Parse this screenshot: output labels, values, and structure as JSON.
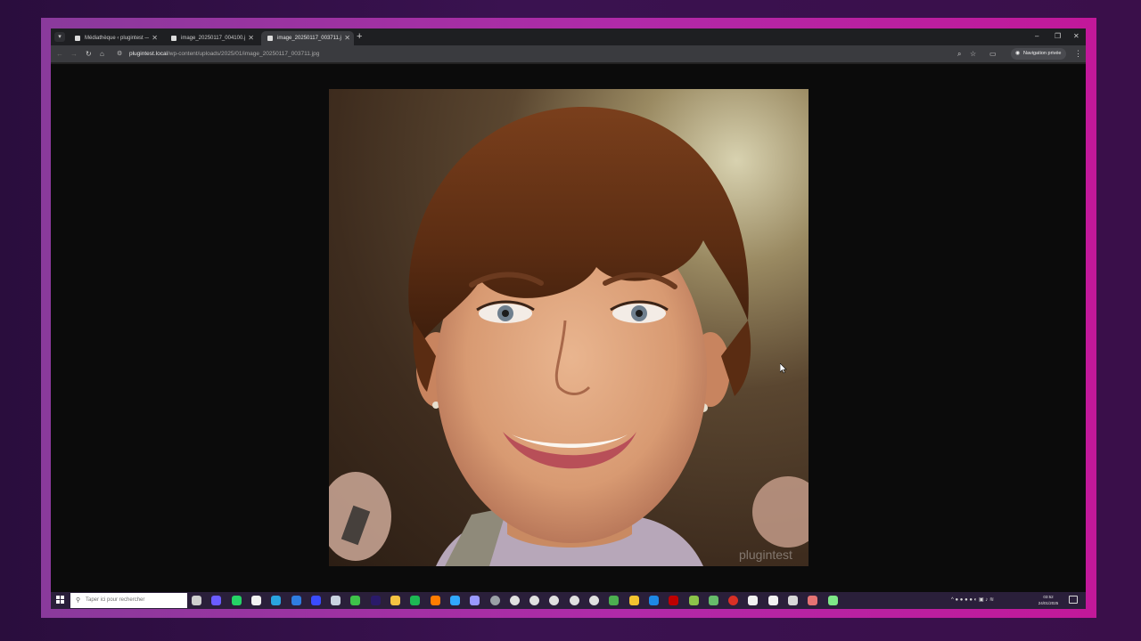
{
  "browser": {
    "tabs": [
      {
        "title": "Médiathèque ‹ plugintest — W",
        "active": false
      },
      {
        "title": "image_20250117_004100.jpg (",
        "active": false
      },
      {
        "title": "image_20250117_003711.jpg (",
        "active": true
      }
    ],
    "new_tab_label": "+",
    "window_controls": {
      "minimize": "–",
      "restore": "❐",
      "close": "✕"
    },
    "nav": {
      "back": "←",
      "forward": "→",
      "reload": "↻",
      "home": "⌂"
    },
    "address": {
      "domain": "plugintest.local",
      "path": "/wp-content/uploads/2025/01/image_20250117_003711.jpg"
    },
    "incognito_label": "Navigation privée"
  },
  "image": {
    "watermark": "plugintest"
  },
  "taskbar": {
    "search_placeholder": "Taper ici pour rechercher",
    "apps": [
      {
        "name": "task-view",
        "color": "#cfcfcf"
      },
      {
        "name": "app-purple",
        "color": "#6b5cff"
      },
      {
        "name": "whatsapp",
        "color": "#25d366"
      },
      {
        "name": "file",
        "color": "#f2f2f2"
      },
      {
        "name": "telegram",
        "color": "#2aa3e0"
      },
      {
        "name": "app-blue-circle",
        "color": "#2f7de1"
      },
      {
        "name": "app-arc",
        "color": "#3a4cff"
      },
      {
        "name": "app-grey",
        "color": "#c9d2e0"
      },
      {
        "name": "app-green",
        "color": "#3ec24a"
      },
      {
        "name": "premiere",
        "color": "#2a1a6a"
      },
      {
        "name": "file-explorer",
        "color": "#f5c242"
      },
      {
        "name": "spotify",
        "color": "#1db954"
      },
      {
        "name": "illustrator",
        "color": "#ff7c00"
      },
      {
        "name": "photoshop",
        "color": "#31a8ff"
      },
      {
        "name": "after-effects",
        "color": "#9999ff"
      },
      {
        "name": "chrome-active",
        "color": "#9aa0a6"
      },
      {
        "name": "chrome-2",
        "color": "#e0e0e0"
      },
      {
        "name": "chrome-3",
        "color": "#e0e0e0"
      },
      {
        "name": "chrome-4",
        "color": "#e0e0e0"
      },
      {
        "name": "chrome-5",
        "color": "#e0e0e0"
      },
      {
        "name": "chrome-6",
        "color": "#e0e0e0"
      },
      {
        "name": "app-green-cube",
        "color": "#4caf50"
      },
      {
        "name": "app-yellow",
        "color": "#f4c430"
      },
      {
        "name": "app-blue",
        "color": "#1e88e5"
      },
      {
        "name": "filezilla",
        "color": "#bf0000"
      },
      {
        "name": "app-lime",
        "color": "#8bc34a"
      },
      {
        "name": "app-mint",
        "color": "#66bb6a"
      },
      {
        "name": "chrome-red",
        "color": "#d93025"
      },
      {
        "name": "app-white",
        "color": "#f2f2f2"
      },
      {
        "name": "app-white-2",
        "color": "#f2f2f2"
      },
      {
        "name": "app-monitor",
        "color": "#d8d8d8"
      },
      {
        "name": "app-tools",
        "color": "#e57373"
      },
      {
        "name": "app-diamond",
        "color": "#7ee787"
      }
    ],
    "tray_icons": "^ ● ● ● ● ◐ ▣ ♪ ≋",
    "clock_time": "03:52",
    "clock_date": "24/01/2025"
  }
}
